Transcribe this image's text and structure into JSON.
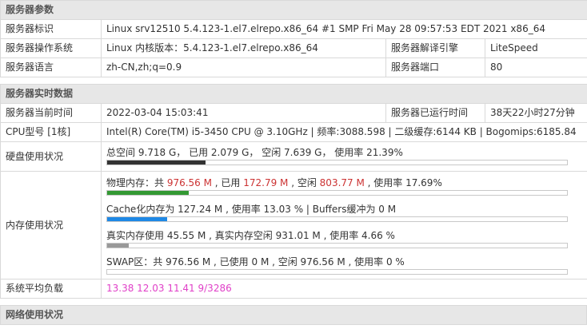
{
  "sections": {
    "params": "服务器参数",
    "realtime": "服务器实时数据",
    "network": "网络使用状况"
  },
  "params": {
    "id_label": "服务器标识",
    "id_value": "Linux srv12510 5.4.123-1.el7.elrepo.x86_64 #1 SMP Fri May 28 09:57:53 EDT 2021 x86_64",
    "os_label": "服务器操作系统",
    "os_value": "Linux  内核版本：5.4.123-1.el7.elrepo.x86_64",
    "engine_label": "服务器解译引擎",
    "engine_value": "LiteSpeed",
    "lang_label": "服务器语言",
    "lang_value": "zh-CN,zh;q=0.9",
    "port_label": "服务器端口",
    "port_value": "80"
  },
  "realtime": {
    "time_label": "服务器当前时间",
    "time_value": "2022-03-04 15:03:41",
    "uptime_label": "服务器已运行时间",
    "uptime_value": "38天22小时27分钟",
    "cpu_label": "CPU型号 [1核]",
    "cpu_value": "Intel(R) Core(TM) i5-3450 CPU @ 3.10GHz | 频率:3088.598 | 二级缓存:6144 KB | Bogomips:6185.84",
    "disk_label": "硬盘使用状况",
    "disk": {
      "text": "总空间 9.718 G， 已用 2.079 G， 空闲 7.639 G， 使用率 21.39%",
      "usage_percent": 21.39,
      "bar_color": "#333333"
    },
    "mem_label": "内存使用状况",
    "mem_physical": {
      "prefix": "物理内存：共 ",
      "total": "976.56 M",
      "used_prefix": " , 已用 ",
      "used": "172.79 M",
      "free_prefix": " , 空闲 ",
      "free": "803.77 M",
      "rate_text": " , 使用率 17.69%",
      "usage_percent": 17.69,
      "bar_color": "#339933"
    },
    "mem_cache": {
      "text": "Cache化内存为 127.24 M , 使用率 13.03 % | Buffers缓冲为 0 M",
      "usage_percent": 13.03,
      "bar_color": "#1e88e5"
    },
    "mem_real": {
      "text": "真实内存使用 45.55 M , 真实内存空闲 931.01 M , 使用率 4.66 %",
      "usage_percent": 4.66,
      "bar_color": "#999999"
    },
    "mem_swap": {
      "text": "SWAP区：共 976.56 M , 已使用 0 M , 空闲 976.56 M , 使用率 0 %",
      "usage_percent": 0,
      "bar_color": "#999999"
    },
    "load_label": "系统平均负载",
    "load_value": "13.38 12.03 11.41 9/3286"
  }
}
